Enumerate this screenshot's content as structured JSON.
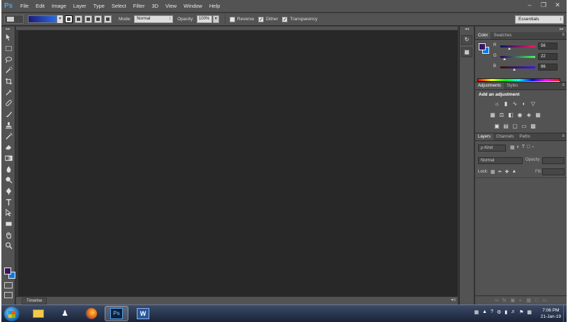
{
  "app": {
    "logo": "Ps"
  },
  "menu": [
    "File",
    "Edit",
    "Image",
    "Layer",
    "Type",
    "Select",
    "Filter",
    "3D",
    "View",
    "Window",
    "Help"
  ],
  "window_buttons": {
    "minimize": "–",
    "restore": "❐",
    "close": "✕"
  },
  "options": {
    "gradient_colors": [
      "#1e1a7a",
      "#2a6de0"
    ],
    "mode_label": "Mode:",
    "mode_value": "Normal",
    "opacity_label": "Opacity:",
    "opacity_value": "100%",
    "reverse_label": "Reverse",
    "reverse_checked": false,
    "dither_label": "Dither",
    "dither_checked": true,
    "transparency_label": "Transparency",
    "transparency_checked": true,
    "workspace": "Essentials"
  },
  "tools": {
    "foreground_color": "#38165f",
    "background_color": "#0a78e8"
  },
  "timeline": {
    "tab": "Timeline"
  },
  "color_panel": {
    "tabs": [
      "Color",
      "Swatches"
    ],
    "r_label": "R",
    "r_value": "56",
    "g_label": "G",
    "g_value": "22",
    "b_label": "B",
    "b_value": "96"
  },
  "adjustments_panel": {
    "tabs": [
      "Adjustments",
      "Styles"
    ],
    "title": "Add an adjustment"
  },
  "layers_panel": {
    "tabs": [
      "Layers",
      "Channels",
      "Paths"
    ],
    "kind_label": "ρ Kind",
    "blend_mode": "Normal",
    "opacity_label": "Opacity:",
    "lock_label": "Lock:",
    "fill_label": "Fill:"
  },
  "taskbar": {
    "time": "7:06 PM",
    "date": "21-Jan-19",
    "active_app": "Photoshop"
  }
}
